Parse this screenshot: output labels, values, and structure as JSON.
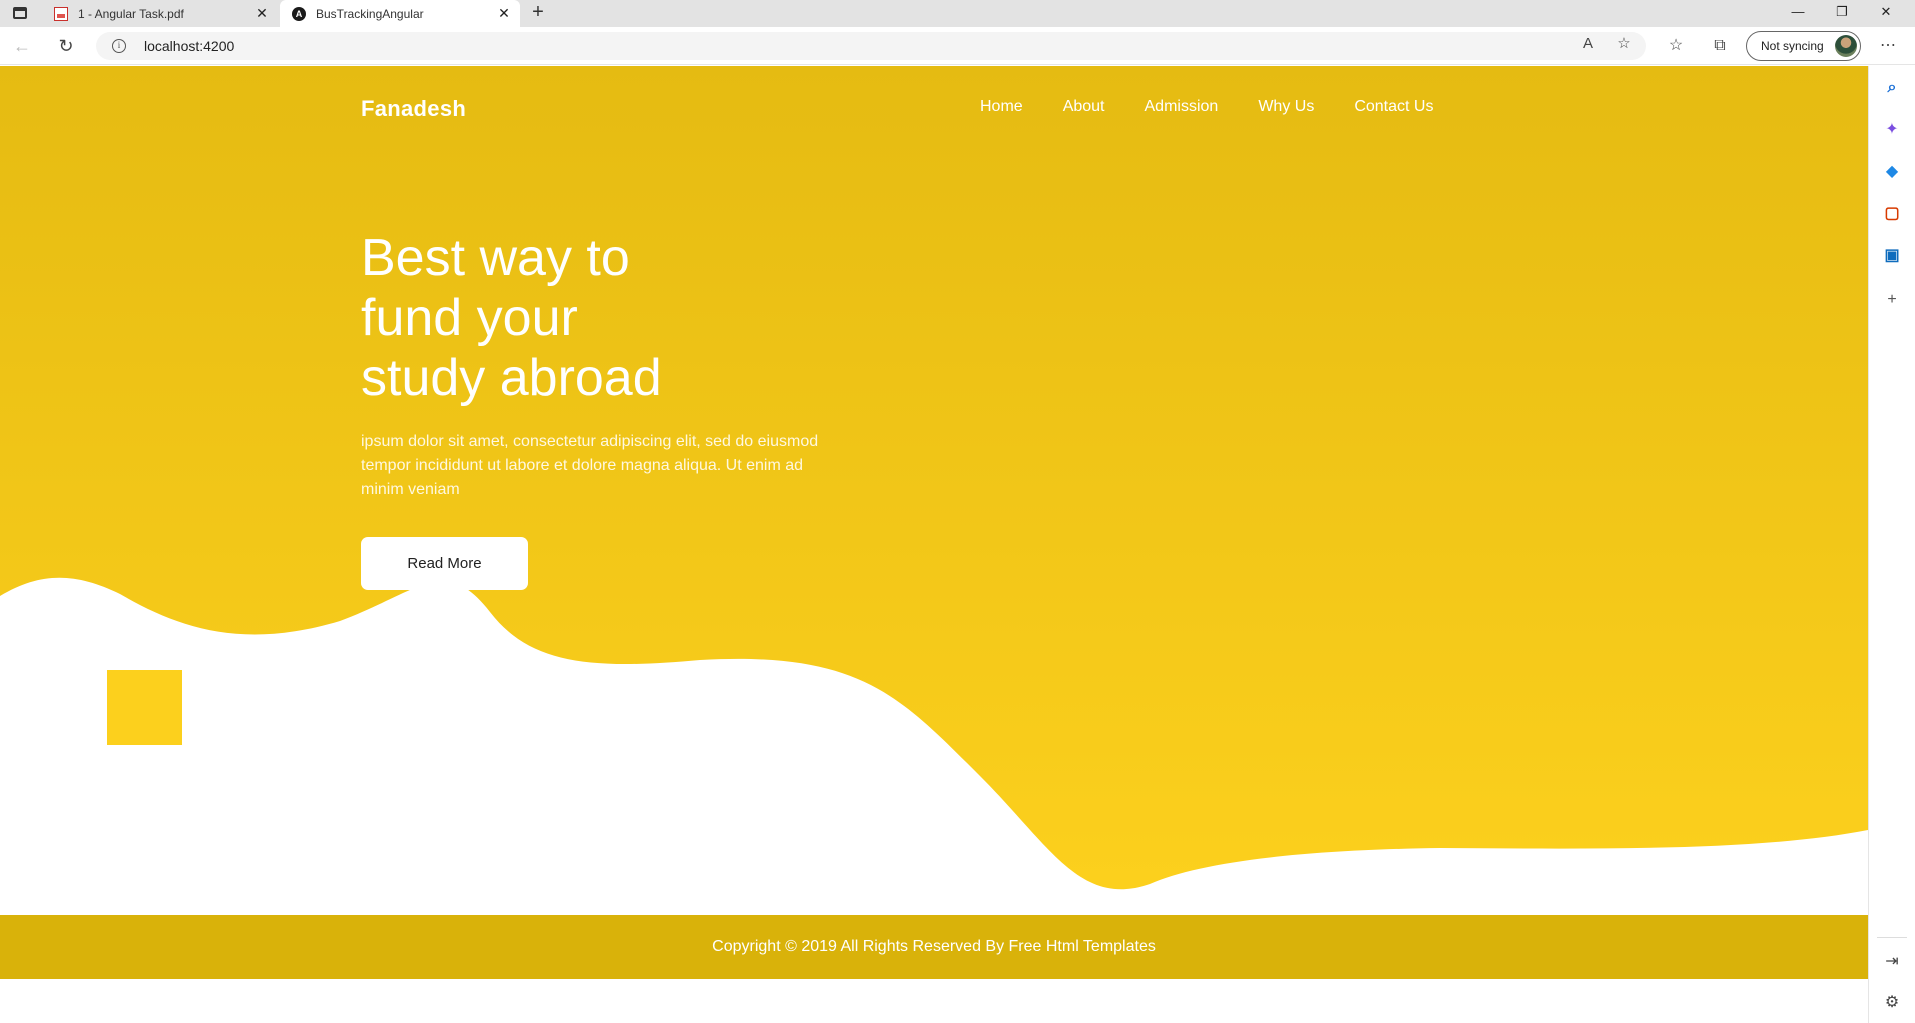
{
  "browser": {
    "tabs": [
      {
        "title": "1 - Angular Task.pdf",
        "icon": "pdf-icon",
        "active": false
      },
      {
        "title": "BusTrackingAngular",
        "icon": "angular-icon",
        "active": true
      }
    ],
    "new_tab_symbol": "+",
    "close_symbol": "✕",
    "address": {
      "url": "localhost:4200"
    },
    "sync_label": "Not syncing"
  },
  "site": {
    "brand": "Fanadesh",
    "nav": [
      "Home",
      "About",
      "Admission",
      "Why Us",
      "Contact Us"
    ],
    "hero": {
      "headline_lines": [
        "Best way to",
        "fund your",
        "study abroad"
      ],
      "subtext": "ipsum dolor sit amet, consectetur adipiscing elit, sed do eiusmod tempor incididunt ut labore et dolore magna aliqua. Ut enim ad minim veniam",
      "button": "Read More"
    },
    "footer": "Copyright © 2019 All Rights Reserved By Free Html Templates",
    "colors": {
      "primary_yellow": "#f2c518",
      "hero_top": "#e5bb12",
      "hero_bottom": "#fcd01d",
      "footer": "#d9b20a",
      "accent_square": "#fcd01d"
    }
  }
}
